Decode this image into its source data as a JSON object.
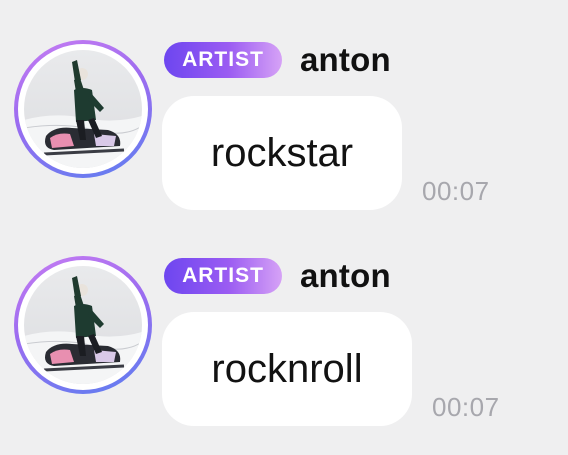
{
  "messages": [
    {
      "badge": "ARTIST",
      "username": "anton",
      "text": "rockstar",
      "time": "00:07",
      "avatar": "avatar-photo-person-on-snowmobile"
    },
    {
      "badge": "ARTIST",
      "username": "anton",
      "text": "rocknroll",
      "time": "00:07",
      "avatar": "avatar-photo-person-on-snowmobile"
    }
  ],
  "colors": {
    "background": "#efeff0",
    "bubble": "#ffffff",
    "badge_gradient_start": "#6d46f0",
    "badge_gradient_end": "#d6a2f6",
    "avatar_ring_start": "#c77cf2",
    "avatar_ring_end": "#5d7ff0",
    "timestamp": "#a7a7ad"
  }
}
